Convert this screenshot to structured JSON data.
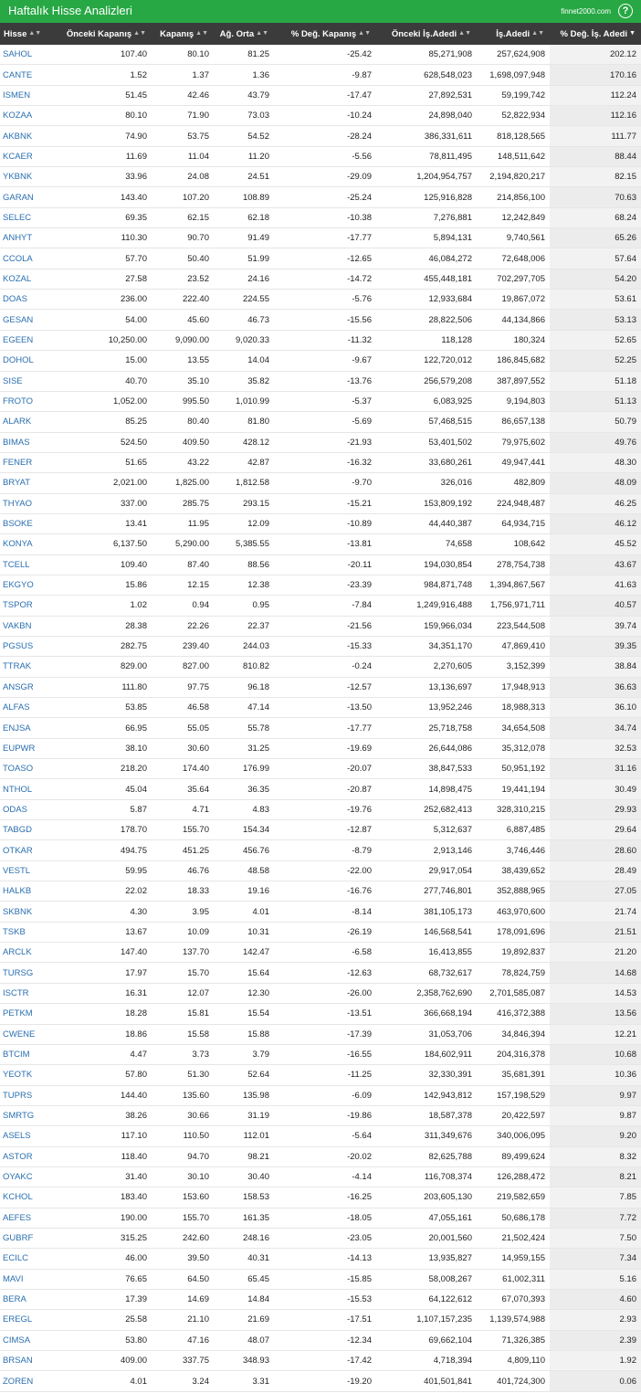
{
  "header": {
    "title": "Haftalık Hisse Analizleri",
    "brand": "finnet2000.com",
    "help_icon": "?"
  },
  "columns": [
    "Hisse",
    "Önceki Kapanış",
    "Kapanış",
    "Ağ. Orta",
    "% Değ. Kapanış",
    "Önceki İş.Adedi",
    "İş.Adedi",
    "% Değ. İş. Adedi"
  ],
  "sort_icons": {
    "unsorted": "▲▼",
    "active": "▼"
  },
  "rows": [
    [
      "SAHOL",
      "107.40",
      "80.10",
      "81.25",
      "-25.42",
      "85,271,908",
      "257,624,908",
      "202.12"
    ],
    [
      "CANTE",
      "1.52",
      "1.37",
      "1.36",
      "-9.87",
      "628,548,023",
      "1,698,097,948",
      "170.16"
    ],
    [
      "ISMEN",
      "51.45",
      "42.46",
      "43.79",
      "-17.47",
      "27,892,531",
      "59,199,742",
      "112.24"
    ],
    [
      "KOZAA",
      "80.10",
      "71.90",
      "73.03",
      "-10.24",
      "24,898,040",
      "52,822,934",
      "112.16"
    ],
    [
      "AKBNK",
      "74.90",
      "53.75",
      "54.52",
      "-28.24",
      "386,331,611",
      "818,128,565",
      "111.77"
    ],
    [
      "KCAER",
      "11.69",
      "11.04",
      "11.20",
      "-5.56",
      "78,811,495",
      "148,511,642",
      "88.44"
    ],
    [
      "YKBNK",
      "33.96",
      "24.08",
      "24.51",
      "-29.09",
      "1,204,954,757",
      "2,194,820,217",
      "82.15"
    ],
    [
      "GARAN",
      "143.40",
      "107.20",
      "108.89",
      "-25.24",
      "125,916,828",
      "214,856,100",
      "70.63"
    ],
    [
      "SELEC",
      "69.35",
      "62.15",
      "62.18",
      "-10.38",
      "7,276,881",
      "12,242,849",
      "68.24"
    ],
    [
      "ANHYT",
      "110.30",
      "90.70",
      "91.49",
      "-17.77",
      "5,894,131",
      "9,740,561",
      "65.26"
    ],
    [
      "CCOLA",
      "57.70",
      "50.40",
      "51.99",
      "-12.65",
      "46,084,272",
      "72,648,006",
      "57.64"
    ],
    [
      "KOZAL",
      "27.58",
      "23.52",
      "24.16",
      "-14.72",
      "455,448,181",
      "702,297,705",
      "54.20"
    ],
    [
      "DOAS",
      "236.00",
      "222.40",
      "224.55",
      "-5.76",
      "12,933,684",
      "19,867,072",
      "53.61"
    ],
    [
      "GESAN",
      "54.00",
      "45.60",
      "46.73",
      "-15.56",
      "28,822,506",
      "44,134,866",
      "53.13"
    ],
    [
      "EGEEN",
      "10,250.00",
      "9,090.00",
      "9,020.33",
      "-11.32",
      "118,128",
      "180,324",
      "52.65"
    ],
    [
      "DOHOL",
      "15.00",
      "13.55",
      "14.04",
      "-9.67",
      "122,720,012",
      "186,845,682",
      "52.25"
    ],
    [
      "SISE",
      "40.70",
      "35.10",
      "35.82",
      "-13.76",
      "256,579,208",
      "387,897,552",
      "51.18"
    ],
    [
      "FROTO",
      "1,052.00",
      "995.50",
      "1,010.99",
      "-5.37",
      "6,083,925",
      "9,194,803",
      "51.13"
    ],
    [
      "ALARK",
      "85.25",
      "80.40",
      "81.80",
      "-5.69",
      "57,468,515",
      "86,657,138",
      "50.79"
    ],
    [
      "BIMAS",
      "524.50",
      "409.50",
      "428.12",
      "-21.93",
      "53,401,502",
      "79,975,602",
      "49.76"
    ],
    [
      "FENER",
      "51.65",
      "43.22",
      "42.87",
      "-16.32",
      "33,680,261",
      "49,947,441",
      "48.30"
    ],
    [
      "BRYAT",
      "2,021.00",
      "1,825.00",
      "1,812.58",
      "-9.70",
      "326,016",
      "482,809",
      "48.09"
    ],
    [
      "THYAO",
      "337.00",
      "285.75",
      "293.15",
      "-15.21",
      "153,809,192",
      "224,948,487",
      "46.25"
    ],
    [
      "BSOKE",
      "13.41",
      "11.95",
      "12.09",
      "-10.89",
      "44,440,387",
      "64,934,715",
      "46.12"
    ],
    [
      "KONYA",
      "6,137.50",
      "5,290.00",
      "5,385.55",
      "-13.81",
      "74,658",
      "108,642",
      "45.52"
    ],
    [
      "TCELL",
      "109.40",
      "87.40",
      "88.56",
      "-20.11",
      "194,030,854",
      "278,754,738",
      "43.67"
    ],
    [
      "EKGYO",
      "15.86",
      "12.15",
      "12.38",
      "-23.39",
      "984,871,748",
      "1,394,867,567",
      "41.63"
    ],
    [
      "TSPOR",
      "1.02",
      "0.94",
      "0.95",
      "-7.84",
      "1,249,916,488",
      "1,756,971,711",
      "40.57"
    ],
    [
      "VAKBN",
      "28.38",
      "22.26",
      "22.37",
      "-21.56",
      "159,966,034",
      "223,544,508",
      "39.74"
    ],
    [
      "PGSUS",
      "282.75",
      "239.40",
      "244.03",
      "-15.33",
      "34,351,170",
      "47,869,410",
      "39.35"
    ],
    [
      "TTRAK",
      "829.00",
      "827.00",
      "810.82",
      "-0.24",
      "2,270,605",
      "3,152,399",
      "38.84"
    ],
    [
      "ANSGR",
      "111.80",
      "97.75",
      "96.18",
      "-12.57",
      "13,136,697",
      "17,948,913",
      "36.63"
    ],
    [
      "ALFAS",
      "53.85",
      "46.58",
      "47.14",
      "-13.50",
      "13,952,246",
      "18,988,313",
      "36.10"
    ],
    [
      "ENJSA",
      "66.95",
      "55.05",
      "55.78",
      "-17.77",
      "25,718,758",
      "34,654,508",
      "34.74"
    ],
    [
      "EUPWR",
      "38.10",
      "30.60",
      "31.25",
      "-19.69",
      "26,644,086",
      "35,312,078",
      "32.53"
    ],
    [
      "TOASO",
      "218.20",
      "174.40",
      "176.99",
      "-20.07",
      "38,847,533",
      "50,951,192",
      "31.16"
    ],
    [
      "NTHOL",
      "45.04",
      "35.64",
      "36.35",
      "-20.87",
      "14,898,475",
      "19,441,194",
      "30.49"
    ],
    [
      "ODAS",
      "5.87",
      "4.71",
      "4.83",
      "-19.76",
      "252,682,413",
      "328,310,215",
      "29.93"
    ],
    [
      "TABGD",
      "178.70",
      "155.70",
      "154.34",
      "-12.87",
      "5,312,637",
      "6,887,485",
      "29.64"
    ],
    [
      "OTKAR",
      "494.75",
      "451.25",
      "456.76",
      "-8.79",
      "2,913,146",
      "3,746,446",
      "28.60"
    ],
    [
      "VESTL",
      "59.95",
      "46.76",
      "48.58",
      "-22.00",
      "29,917,054",
      "38,439,652",
      "28.49"
    ],
    [
      "HALKB",
      "22.02",
      "18.33",
      "19.16",
      "-16.76",
      "277,746,801",
      "352,888,965",
      "27.05"
    ],
    [
      "SKBNK",
      "4.30",
      "3.95",
      "4.01",
      "-8.14",
      "381,105,173",
      "463,970,600",
      "21.74"
    ],
    [
      "TSKB",
      "13.67",
      "10.09",
      "10.31",
      "-26.19",
      "146,568,541",
      "178,091,696",
      "21.51"
    ],
    [
      "ARCLK",
      "147.40",
      "137.70",
      "142.47",
      "-6.58",
      "16,413,855",
      "19,892,837",
      "21.20"
    ],
    [
      "TURSG",
      "17.97",
      "15.70",
      "15.64",
      "-12.63",
      "68,732,617",
      "78,824,759",
      "14.68"
    ],
    [
      "ISCTR",
      "16.31",
      "12.07",
      "12.30",
      "-26.00",
      "2,358,762,690",
      "2,701,585,087",
      "14.53"
    ],
    [
      "PETKM",
      "18.28",
      "15.81",
      "15.54",
      "-13.51",
      "366,668,194",
      "416,372,388",
      "13.56"
    ],
    [
      "CWENE",
      "18.86",
      "15.58",
      "15.88",
      "-17.39",
      "31,053,706",
      "34,846,394",
      "12.21"
    ],
    [
      "BTCIM",
      "4.47",
      "3.73",
      "3.79",
      "-16.55",
      "184,602,911",
      "204,316,378",
      "10.68"
    ],
    [
      "YEOTK",
      "57.80",
      "51.30",
      "52.64",
      "-11.25",
      "32,330,391",
      "35,681,391",
      "10.36"
    ],
    [
      "TUPRS",
      "144.40",
      "135.60",
      "135.98",
      "-6.09",
      "142,943,812",
      "157,198,529",
      "9.97"
    ],
    [
      "SMRTG",
      "38.26",
      "30.66",
      "31.19",
      "-19.86",
      "18,587,378",
      "20,422,597",
      "9.87"
    ],
    [
      "ASELS",
      "117.10",
      "110.50",
      "112.01",
      "-5.64",
      "311,349,676",
      "340,006,095",
      "9.20"
    ],
    [
      "ASTOR",
      "118.40",
      "94.70",
      "98.21",
      "-20.02",
      "82,625,788",
      "89,499,624",
      "8.32"
    ],
    [
      "OYAKC",
      "31.40",
      "30.10",
      "30.40",
      "-4.14",
      "116,708,374",
      "126,288,472",
      "8.21"
    ],
    [
      "KCHOL",
      "183.40",
      "153.60",
      "158.53",
      "-16.25",
      "203,605,130",
      "219,582,659",
      "7.85"
    ],
    [
      "AEFES",
      "190.00",
      "155.70",
      "161.35",
      "-18.05",
      "47,055,161",
      "50,686,178",
      "7.72"
    ],
    [
      "GUBRF",
      "315.25",
      "242.60",
      "248.16",
      "-23.05",
      "20,001,560",
      "21,502,424",
      "7.50"
    ],
    [
      "ECILC",
      "46.00",
      "39.50",
      "40.31",
      "-14.13",
      "13,935,827",
      "14,959,155",
      "7.34"
    ],
    [
      "MAVI",
      "76.65",
      "64.50",
      "65.45",
      "-15.85",
      "58,008,267",
      "61,002,311",
      "5.16"
    ],
    [
      "BERA",
      "17.39",
      "14.69",
      "14.84",
      "-15.53",
      "64,122,612",
      "67,070,393",
      "4.60"
    ],
    [
      "EREGL",
      "25.58",
      "21.10",
      "21.69",
      "-17.51",
      "1,107,157,235",
      "1,139,574,988",
      "2.93"
    ],
    [
      "CIMSA",
      "53.80",
      "47.16",
      "48.07",
      "-12.34",
      "69,662,104",
      "71,326,385",
      "2.39"
    ],
    [
      "BRSAN",
      "409.00",
      "337.75",
      "348.93",
      "-17.42",
      "4,718,394",
      "4,809,110",
      "1.92"
    ],
    [
      "ZOREN",
      "4.01",
      "3.24",
      "3.31",
      "-19.20",
      "401,501,841",
      "401,724,300",
      "0.06"
    ]
  ]
}
